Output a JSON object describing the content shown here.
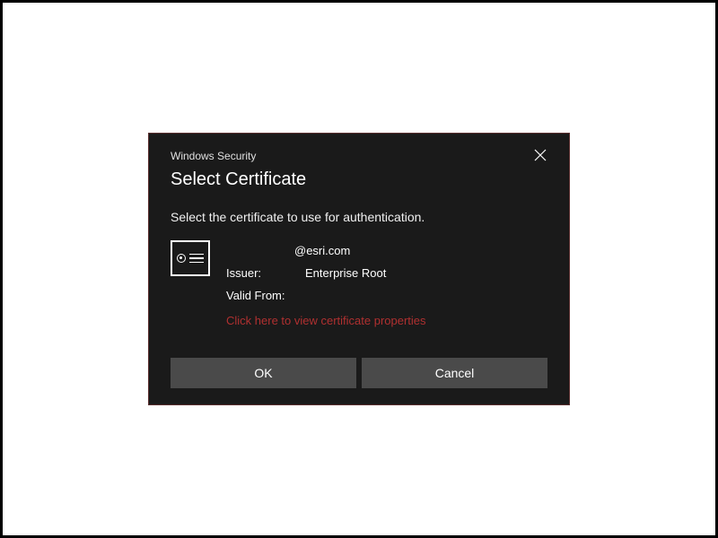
{
  "app_title": "Windows Security",
  "dialog_title": "Select Certificate",
  "instruction": "Select the certificate to use for authentication.",
  "certificate": {
    "subject": "@esri.com",
    "issuer_label": "Issuer:",
    "issuer_value": "Enterprise Root",
    "valid_from_label": "Valid From:",
    "valid_from_value": "",
    "properties_link": "Click here to view certificate properties"
  },
  "buttons": {
    "ok": "OK",
    "cancel": "Cancel"
  }
}
